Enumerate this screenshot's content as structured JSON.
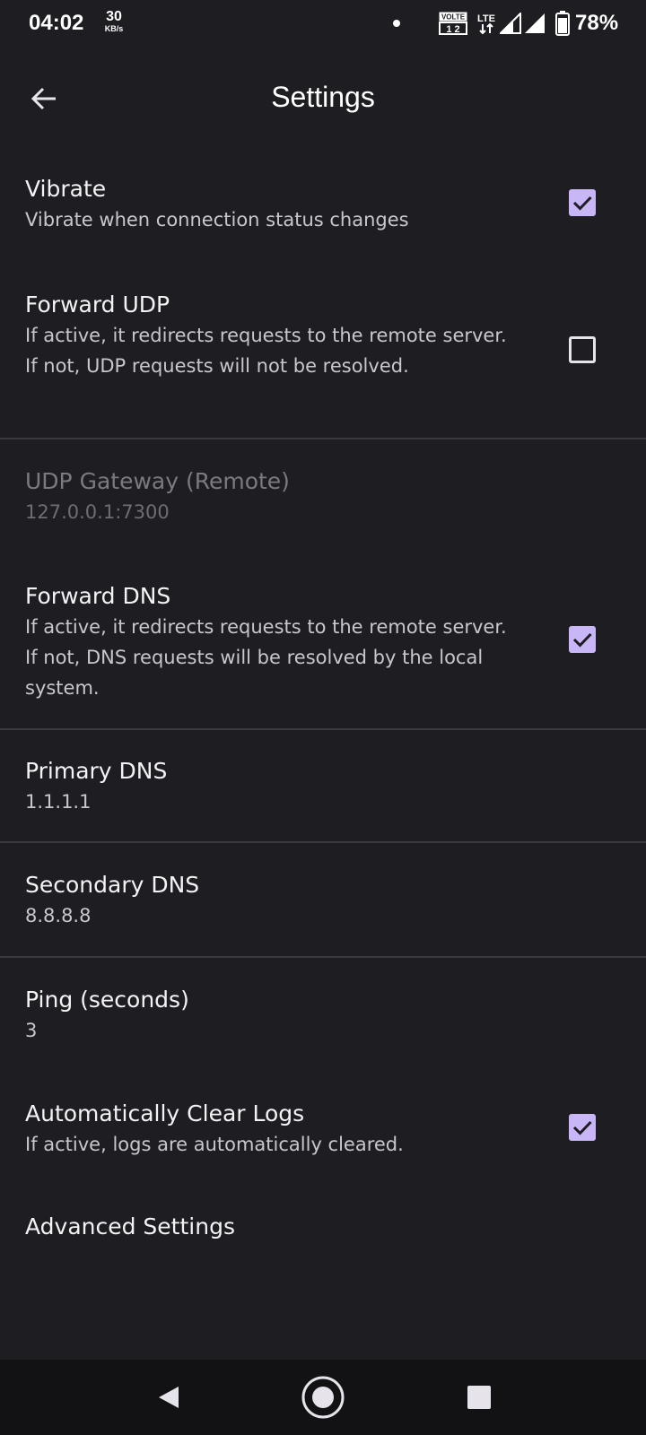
{
  "status_bar": {
    "time": "04:02",
    "net_speed_value": "30",
    "net_speed_unit": "KB/s",
    "volte_label": "VOLTE",
    "lte_label": "LTE",
    "battery_percent": "78%"
  },
  "app_bar": {
    "title": "Settings",
    "back_icon": "arrow-left-icon"
  },
  "settings": [
    {
      "title": "Vibrate",
      "summary": "Vibrate when connection status changes",
      "checkbox": true,
      "enabled": true
    },
    {
      "title": "Forward UDP",
      "summary": "If active, it redirects requests to the remote server. If not, UDP requests will not be resolved.",
      "checkbox": false,
      "enabled": true
    },
    {
      "title": "UDP Gateway (Remote)",
      "summary": "127.0.0.1:7300",
      "enabled": false
    },
    {
      "title": "Forward DNS",
      "summary": "If active, it redirects requests to the remote server. If not, DNS requests will be resolved by the local system.",
      "checkbox": true,
      "enabled": true
    },
    {
      "title": "Primary DNS",
      "summary": "1.1.1.1",
      "enabled": true
    },
    {
      "title": "Secondary DNS",
      "summary": "8.8.8.8",
      "enabled": true
    },
    {
      "title": "Ping (seconds)",
      "summary": "3",
      "enabled": true
    },
    {
      "title": "Automatically Clear Logs",
      "summary": "If active, logs are automatically cleared.",
      "checkbox": true,
      "enabled": true
    },
    {
      "title": "Advanced Settings",
      "enabled": true
    }
  ],
  "colors": {
    "background": "#1e1d22",
    "checkbox_checked": "#c9b6f6",
    "divider": "#3a393f",
    "nav_bar": "#121214"
  },
  "nav_bar": {
    "back_icon": "triangle-back-icon",
    "home_icon": "circle-home-icon",
    "recents_icon": "square-recents-icon"
  }
}
